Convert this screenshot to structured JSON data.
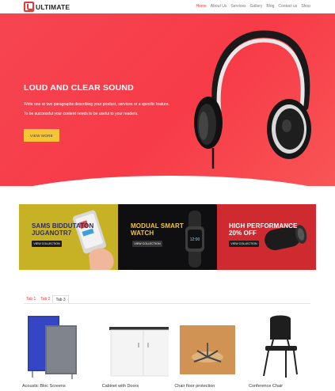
{
  "header": {
    "logo_letter": "U",
    "logo_text": "ULTIMATE",
    "nav": [
      "Home",
      "About Us",
      "Services",
      "Gallery",
      "Blog",
      "Contact us",
      "Shop"
    ]
  },
  "hero": {
    "title": "LOUD AND CLEAR SOUND",
    "p1": "Write one or two paragraphs describing your product, services or a specific feature.",
    "p2": "To be successful your content needs to be useful to your readers.",
    "button": "VIEW MORE"
  },
  "banners": [
    {
      "title_l1": "SAMS BIDDUTATON",
      "title_l2": "JUGANOTR7",
      "button": "VIEW COLLECTION"
    },
    {
      "title_l1": "MODUAL SMART",
      "title_l2": "WATCH",
      "button": "VIEW COLLECTION"
    },
    {
      "title_l1": "HIGH PERFORMANCE",
      "title_l2": "20% OFF",
      "button": "VIEW COLLECTION"
    }
  ],
  "tabs": [
    "Tab 1",
    "Tab 2",
    "Tab 3"
  ],
  "products": [
    {
      "name": "Acoustic Bloc Screens"
    },
    {
      "name": "Cabinet with Doors"
    },
    {
      "name": "Chair floor protection"
    },
    {
      "name": "Conference Chair"
    }
  ],
  "colors": {
    "accent": "#e53935",
    "hero": "#f64551",
    "button": "#f5c535"
  }
}
